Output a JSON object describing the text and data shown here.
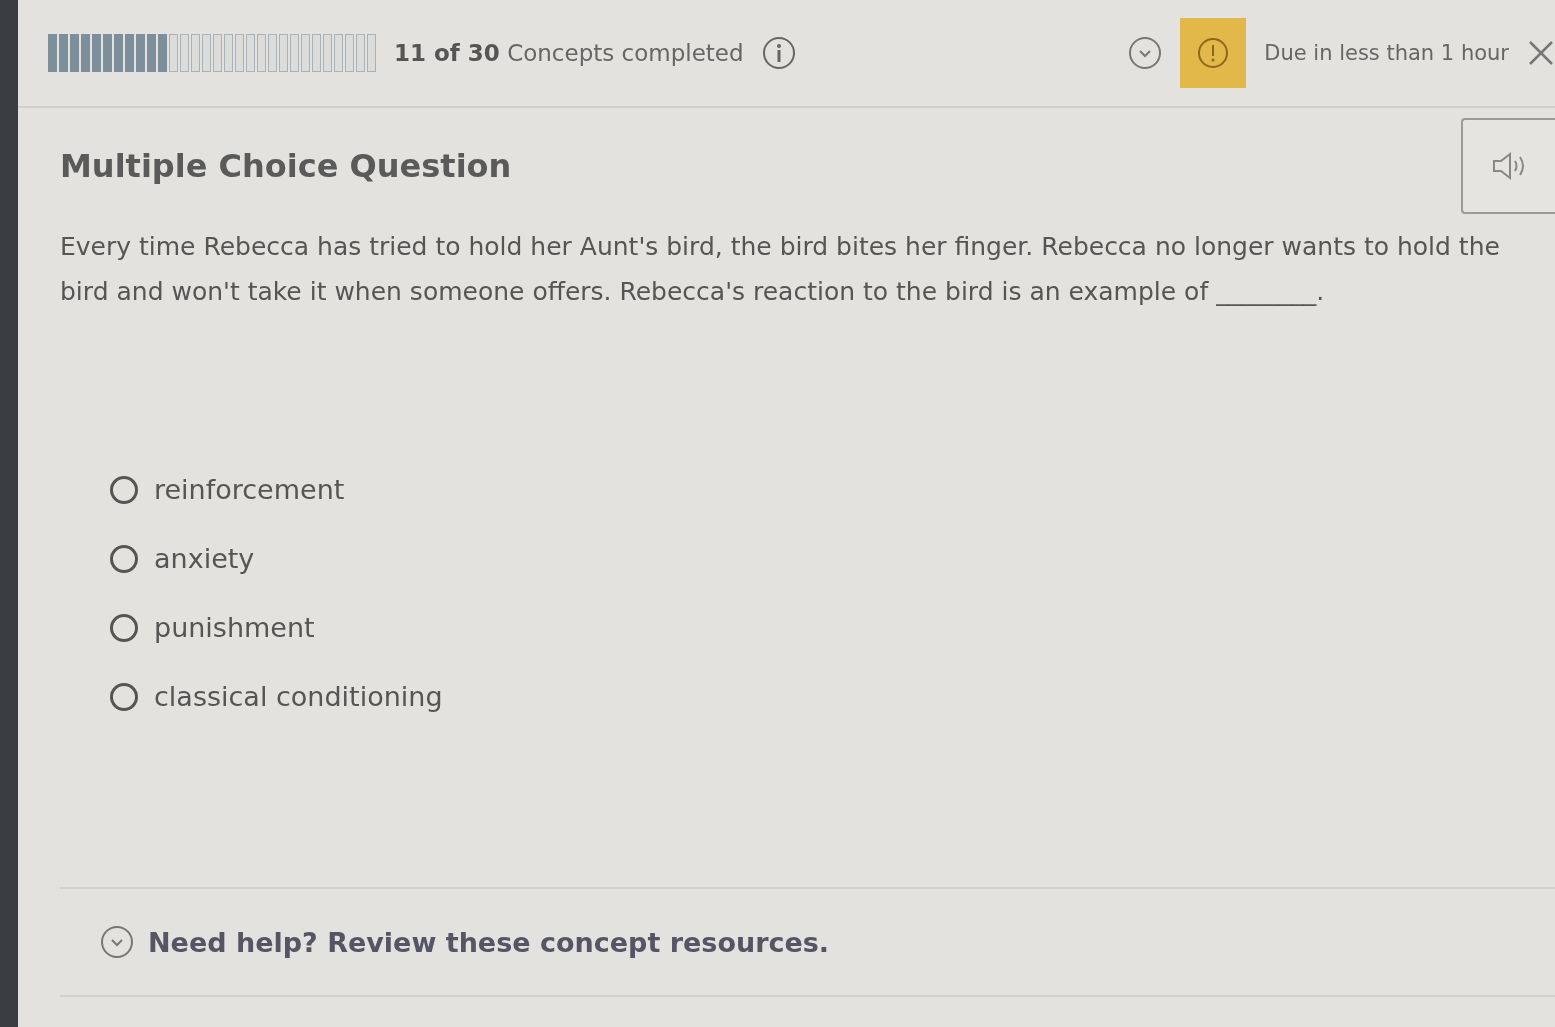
{
  "progress": {
    "level": 0.3667,
    "completed": "11 of 30",
    "label": "Concepts completed"
  },
  "due": {
    "text": "Due in less than 1 hour"
  },
  "question": {
    "title": "Multiple Choice Question",
    "text": "Every time Rebecca has tried to hold her Aunt's bird, the bird bites her finger. Rebecca no longer wants to hold the bird and won't take it when someone offers. Rebecca's reaction to the bird is an example of ________."
  },
  "options": [
    {
      "label": "reinforcement",
      "selected": false
    },
    {
      "label": "anxiety",
      "selected": false
    },
    {
      "label": "punishment",
      "selected": false
    },
    {
      "label": "classical conditioning",
      "selected": false
    }
  ],
  "help": {
    "text": "Need help? Review these concept resources."
  }
}
